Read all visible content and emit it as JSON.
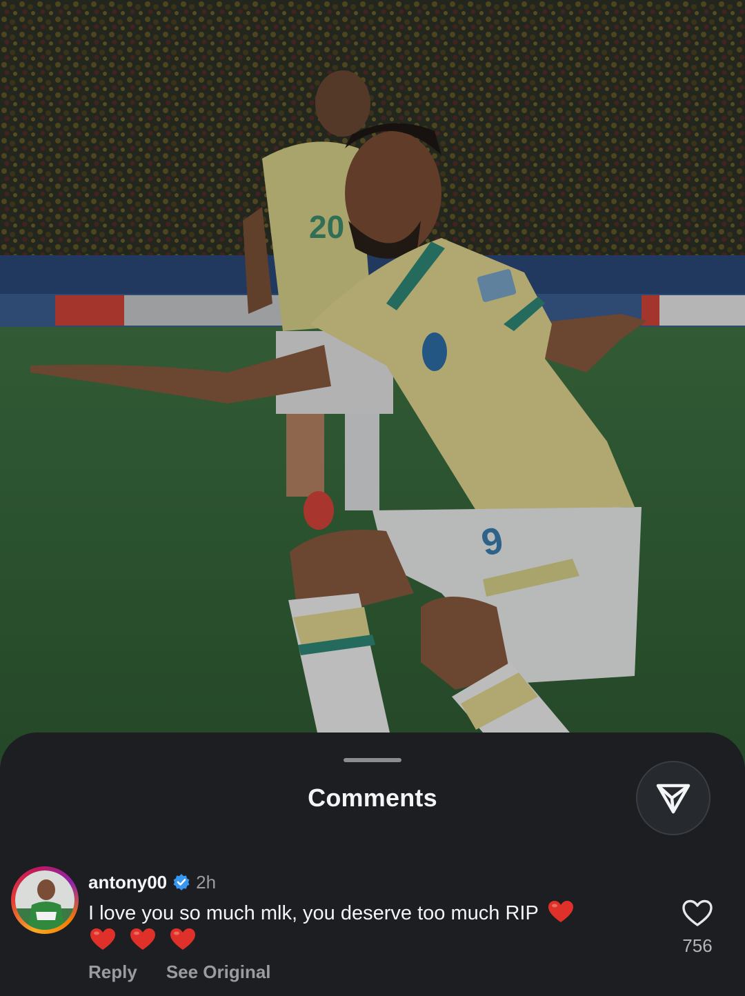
{
  "photo": {
    "description_icon": "football-celebration-photo"
  },
  "sheet": {
    "title": "Comments",
    "send_icon": "send-paper-plane-icon"
  },
  "comment": {
    "username": "antony00",
    "verified_icon": "verified-badge-icon",
    "time": "2h",
    "text": "I love you so much mlk, you deserve too much RIP",
    "emoji": "heart-emoji",
    "reply_label": "Reply",
    "see_original_label": "See Original",
    "like_icon": "heart-outline-icon",
    "likes": "756"
  },
  "colors": {
    "sheet_bg": "#1c1e22",
    "text_primary": "#f4f5f6",
    "text_secondary": "#9a9ca1",
    "verified": "#3897f0",
    "heart": "#e0302a"
  }
}
